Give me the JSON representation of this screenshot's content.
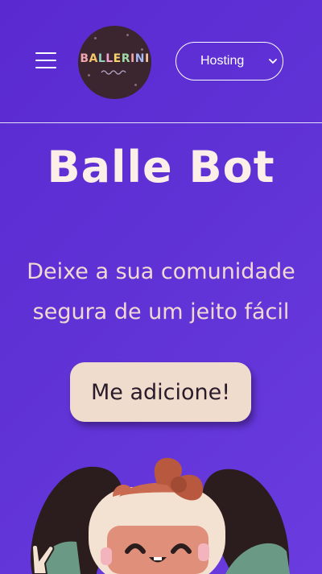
{
  "header": {
    "menu_icon": "hamburger-menu-icon",
    "logo": {
      "letters": [
        "B",
        "A",
        "L",
        "L",
        "E",
        "R",
        "I",
        "N",
        "I"
      ],
      "colors": [
        "#f0a5b0",
        "#f6c46b",
        "#8fd0c0",
        "#f2a3c8",
        "#f6d36b",
        "#9fd7a6",
        "#f4a3a3",
        "#a9b8f0",
        "#f7c9a2"
      ]
    },
    "language_select": {
      "value": "Hosting",
      "icon": "chevron-down-icon"
    }
  },
  "hero": {
    "title": "Balle Bot",
    "subtitle": "Deixe a sua comunidade segura de um jeito fácil",
    "cta_label": "Me adicione!"
  },
  "colors": {
    "background": "#5f32d6",
    "title": "#fcefe8",
    "subtitle": "#f2d8d2",
    "button_bg": "#f0dccc",
    "button_text": "#2a1b2b"
  }
}
